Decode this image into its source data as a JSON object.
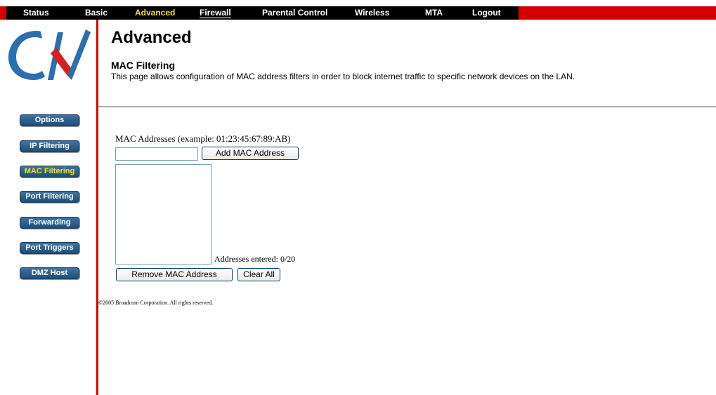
{
  "nav": {
    "items": [
      {
        "label": "Status"
      },
      {
        "label": "Basic"
      },
      {
        "label": "Advanced"
      },
      {
        "label": "Firewall"
      },
      {
        "label": "Parental Control"
      },
      {
        "label": "Wireless"
      },
      {
        "label": "MTA"
      },
      {
        "label": "Logout"
      }
    ],
    "active": "Advanced"
  },
  "sidebar": {
    "items": [
      {
        "label": "Options"
      },
      {
        "label": "IP Filtering"
      },
      {
        "label": "MAC Filtering"
      },
      {
        "label": "Port Filtering"
      },
      {
        "label": "Forwarding"
      },
      {
        "label": "Port Triggers"
      },
      {
        "label": "DMZ Host"
      }
    ],
    "active": "MAC Filtering"
  },
  "header": {
    "title": "Advanced",
    "section": "MAC Filtering",
    "description": "This page allows configuration of MAC address filters in order to block internet traffic to specific network devices on the LAN."
  },
  "form": {
    "mac_label": "MAC Addresses (example: 01:23:45:67:89:AB)",
    "mac_input_value": "",
    "add_button": "Add MAC Address",
    "remove_button": "Remove MAC Address",
    "clear_button": "Clear All",
    "entered_count": "Addresses entered: 0/20"
  },
  "footer": {
    "copyright": "©2005 Broadcom Corporation. All rights reserved."
  },
  "colors": {
    "nav_red": "#d40000",
    "nav_black": "#000000",
    "active_yellow": "#f3e21a",
    "sidebar_blue": "#2a5b86"
  },
  "logo": {
    "icon": "cnv-logo"
  }
}
